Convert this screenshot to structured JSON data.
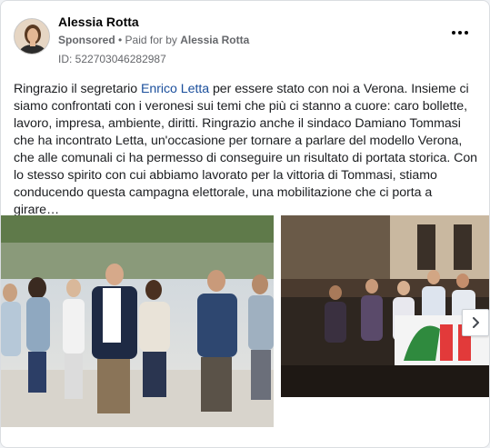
{
  "post": {
    "author": "Alessia Rotta",
    "sponsored_label": "Sponsored",
    "separator": " • ",
    "paid_for_prefix": "Paid for by ",
    "paid_for_name": "Alessia Rotta",
    "ad_id": "ID: 522703046282987",
    "text_before_link": "Ringrazio il segretario ",
    "text_link": "Enrico Letta",
    "text_after_link": " per essere stato con noi a Verona. Insieme ci siamo confrontati con i veronesi sui temi che più ci stanno a cuore: caro bollette, lavoro, impresa, ambiente, diritti. Ringrazio anche il sindaco Damiano Tommasi che ha incontrato Letta, un'occasione per tornare a parlare del modello Verona, che alle comunali ci ha permesso di conseguire un risultato di portata storica. Con lo stesso spirito con cui abbiamo lavorato per la vittoria di Tommasi, stiamo conducendo questa campagna elettorale, una mobilitazione che ci porta a girare…"
  },
  "icons": {
    "more": "more-horizontal-icon",
    "next": "chevron-right-icon"
  },
  "colors": {
    "link": "#1b4f9c",
    "secondary_text": "#65676b",
    "card_border": "#dadde1"
  }
}
